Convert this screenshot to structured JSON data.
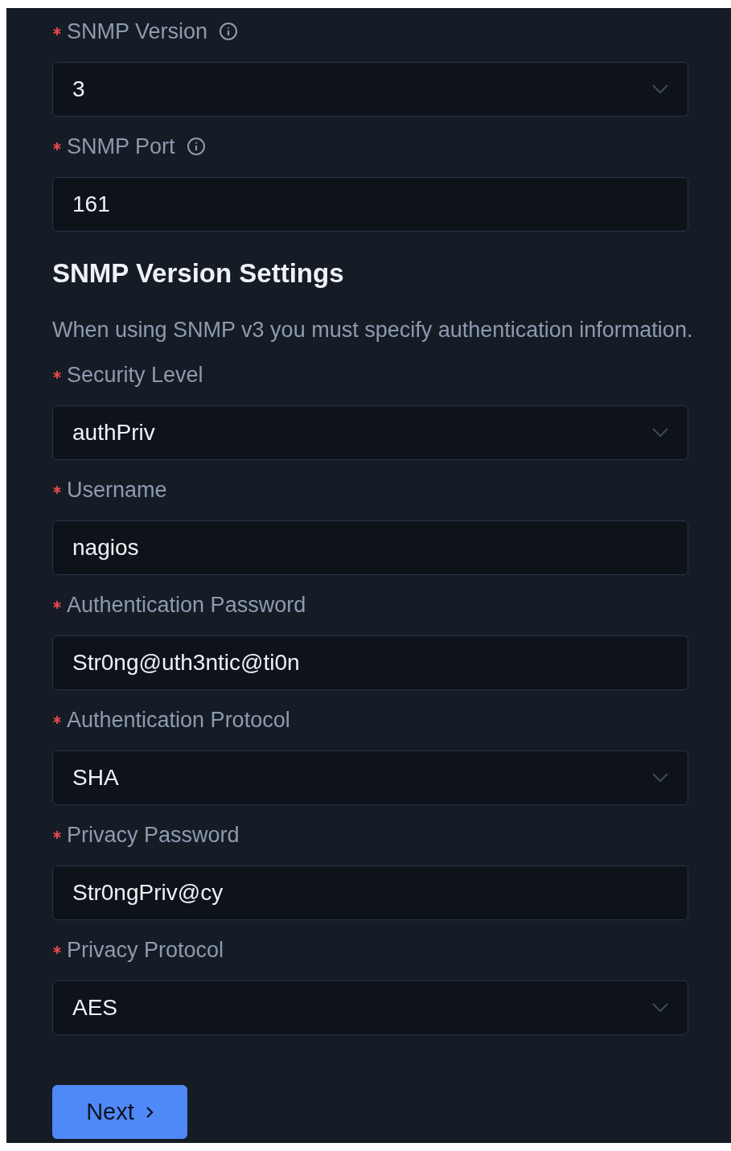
{
  "fields_top": [
    {
      "label": "SNMP Version",
      "required": true,
      "info": true,
      "kind": "select",
      "value": "3"
    },
    {
      "label": "SNMP Port",
      "required": true,
      "info": true,
      "kind": "text",
      "value": "161"
    }
  ],
  "section": {
    "title": "SNMP Version Settings",
    "description": "When using SNMP v3 you must specify authentication information."
  },
  "fields": [
    {
      "label": "Security Level",
      "required": true,
      "info": false,
      "kind": "select",
      "value": "authPriv"
    },
    {
      "label": "Username",
      "required": true,
      "info": false,
      "kind": "text",
      "value": "nagios"
    },
    {
      "label": "Authentication Password",
      "required": true,
      "info": false,
      "kind": "text",
      "value": "Str0ng@uth3ntic@ti0n"
    },
    {
      "label": "Authentication Protocol",
      "required": true,
      "info": false,
      "kind": "select",
      "value": "SHA"
    },
    {
      "label": "Privacy Password",
      "required": true,
      "info": false,
      "kind": "text",
      "value": "Str0ngPriv@cy"
    },
    {
      "label": "Privacy Protocol",
      "required": true,
      "info": false,
      "kind": "select",
      "value": "AES"
    }
  ],
  "next_button": {
    "label": "Next"
  }
}
